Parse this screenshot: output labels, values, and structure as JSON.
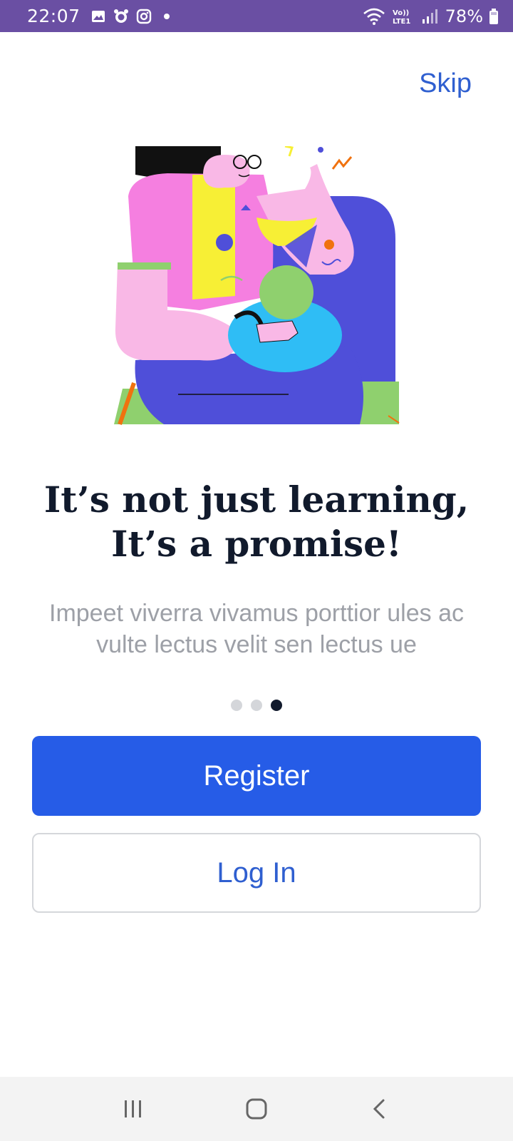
{
  "status_bar": {
    "time": "22:07",
    "battery": "78%",
    "network_label": "Vo)) LTE1",
    "background_color": "#6a4fa3"
  },
  "skip_label": "Skip",
  "headline": {
    "line1": "It’s not just learning,",
    "line2": "It’s a promise!"
  },
  "subtitle": "Impeet viverra vivamus porttior ules ac vulte lectus velit sen lectus ue",
  "pager": {
    "count": 3,
    "active_index": 2
  },
  "buttons": {
    "register": "Register",
    "login": "Log In"
  },
  "colors": {
    "primary": "#265ce7",
    "link": "#2f5fd0",
    "heading": "#111a2c",
    "subtitle": "#9da0a7"
  },
  "icons": {
    "status_left": [
      "gallery-icon",
      "alarm-icon",
      "instagram-icon",
      "dot-icon"
    ],
    "status_right": [
      "wifi-icon",
      "lte-icon",
      "signal-icon",
      "battery-icon"
    ],
    "nav": [
      "recent-apps-icon",
      "home-icon",
      "back-icon"
    ]
  }
}
